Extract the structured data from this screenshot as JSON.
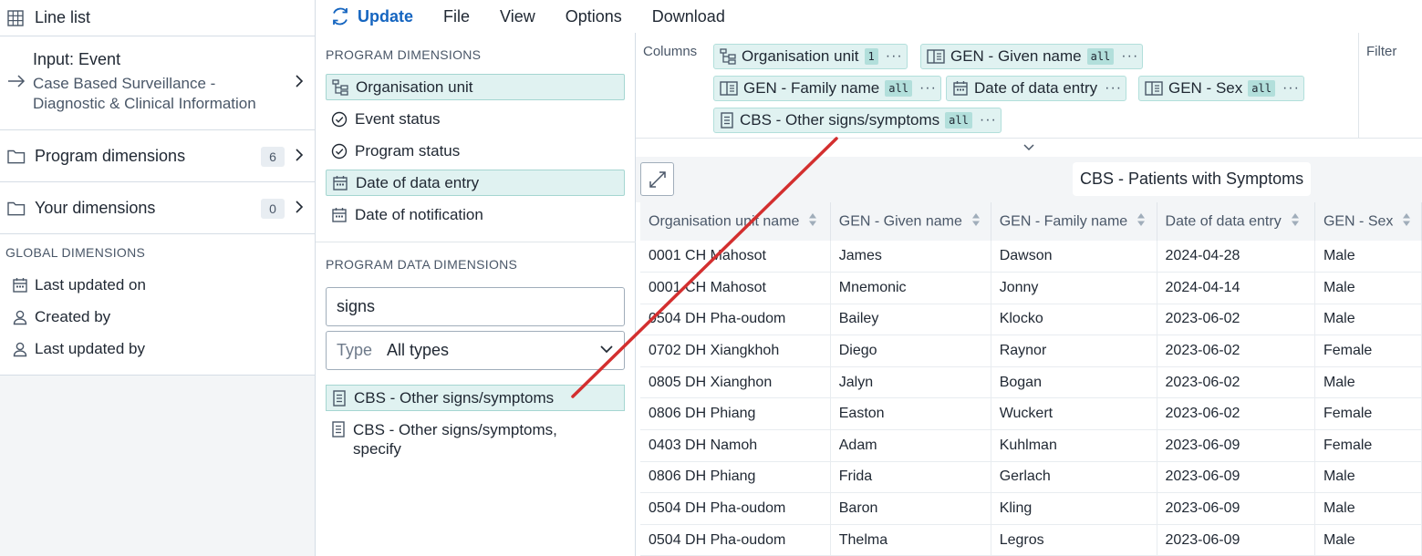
{
  "app": {
    "title": "Line list"
  },
  "input": {
    "label": "Input: Event",
    "program": "Case Based Surveillance - Diagnostic & Clinical Information"
  },
  "sidebar": {
    "program_dimensions": {
      "label": "Program dimensions",
      "count": "6"
    },
    "your_dimensions": {
      "label": "Your dimensions",
      "count": "0"
    },
    "global": {
      "heading": "GLOBAL DIMENSIONS",
      "items": [
        "Last updated on",
        "Created by",
        "Last updated by"
      ]
    }
  },
  "menu": {
    "update": "Update",
    "items": [
      "File",
      "View",
      "Options",
      "Download"
    ]
  },
  "program_panel": {
    "heading": "PROGRAM DIMENSIONS",
    "items": [
      "Organisation unit",
      "Event status",
      "Program status",
      "Date of data entry",
      "Date of notification"
    ],
    "data_heading": "PROGRAM DATA DIMENSIONS",
    "search_value": "signs",
    "type_label": "Type",
    "type_value": "All types",
    "results": [
      "CBS - Other signs/symptoms",
      "CBS - Other signs/symptoms, specify"
    ]
  },
  "layout": {
    "columns_label": "Columns",
    "filter_label": "Filter",
    "chips": [
      {
        "label": "Organisation unit",
        "badge": "1"
      },
      {
        "label": "GEN - Given name",
        "badge": "all"
      },
      {
        "label": "GEN - Family name",
        "badge": "all"
      },
      {
        "label": "Date of data entry",
        "badge": ""
      },
      {
        "label": "GEN - Sex",
        "badge": "all"
      },
      {
        "label": "CBS - Other signs/symptoms",
        "badge": "all"
      }
    ],
    "more": "···"
  },
  "visualization": {
    "title": "CBS - Patients with Symptoms"
  },
  "table": {
    "headers": [
      "Organisation unit name",
      "GEN - Given name",
      "GEN - Family name",
      "Date of data entry",
      "GEN - Sex"
    ],
    "rows": [
      [
        "0001 CH Mahosot",
        "James",
        "Dawson",
        "2024-04-28",
        "Male"
      ],
      [
        "0001 CH Mahosot",
        "Mnemonic",
        "Jonny",
        "2024-04-14",
        "Male"
      ],
      [
        "0504 DH Pha-oudom",
        "Bailey",
        "Klocko",
        "2023-06-02",
        "Male"
      ],
      [
        "0702 DH Xiangkhoh",
        "Diego",
        "Raynor",
        "2023-06-02",
        "Female"
      ],
      [
        "0805 DH Xianghon",
        "Jalyn",
        "Bogan",
        "2023-06-02",
        "Male"
      ],
      [
        "0806 DH Phiang",
        "Easton",
        "Wuckert",
        "2023-06-02",
        "Female"
      ],
      [
        "0403 DH Namoh",
        "Adam",
        "Kuhlman",
        "2023-06-09",
        "Female"
      ],
      [
        "0806 DH Phiang",
        "Frida",
        "Gerlach",
        "2023-06-09",
        "Male"
      ],
      [
        "0504 DH Pha-oudom",
        "Baron",
        "Kling",
        "2023-06-09",
        "Male"
      ],
      [
        "0504 DH Pha-oudom",
        "Thelma",
        "Legros",
        "2023-06-09",
        "Male"
      ]
    ]
  },
  "colors": {
    "accent": "#1565c0",
    "selected_bg": "#e0f2f1",
    "annotation": "#d32f2f"
  }
}
